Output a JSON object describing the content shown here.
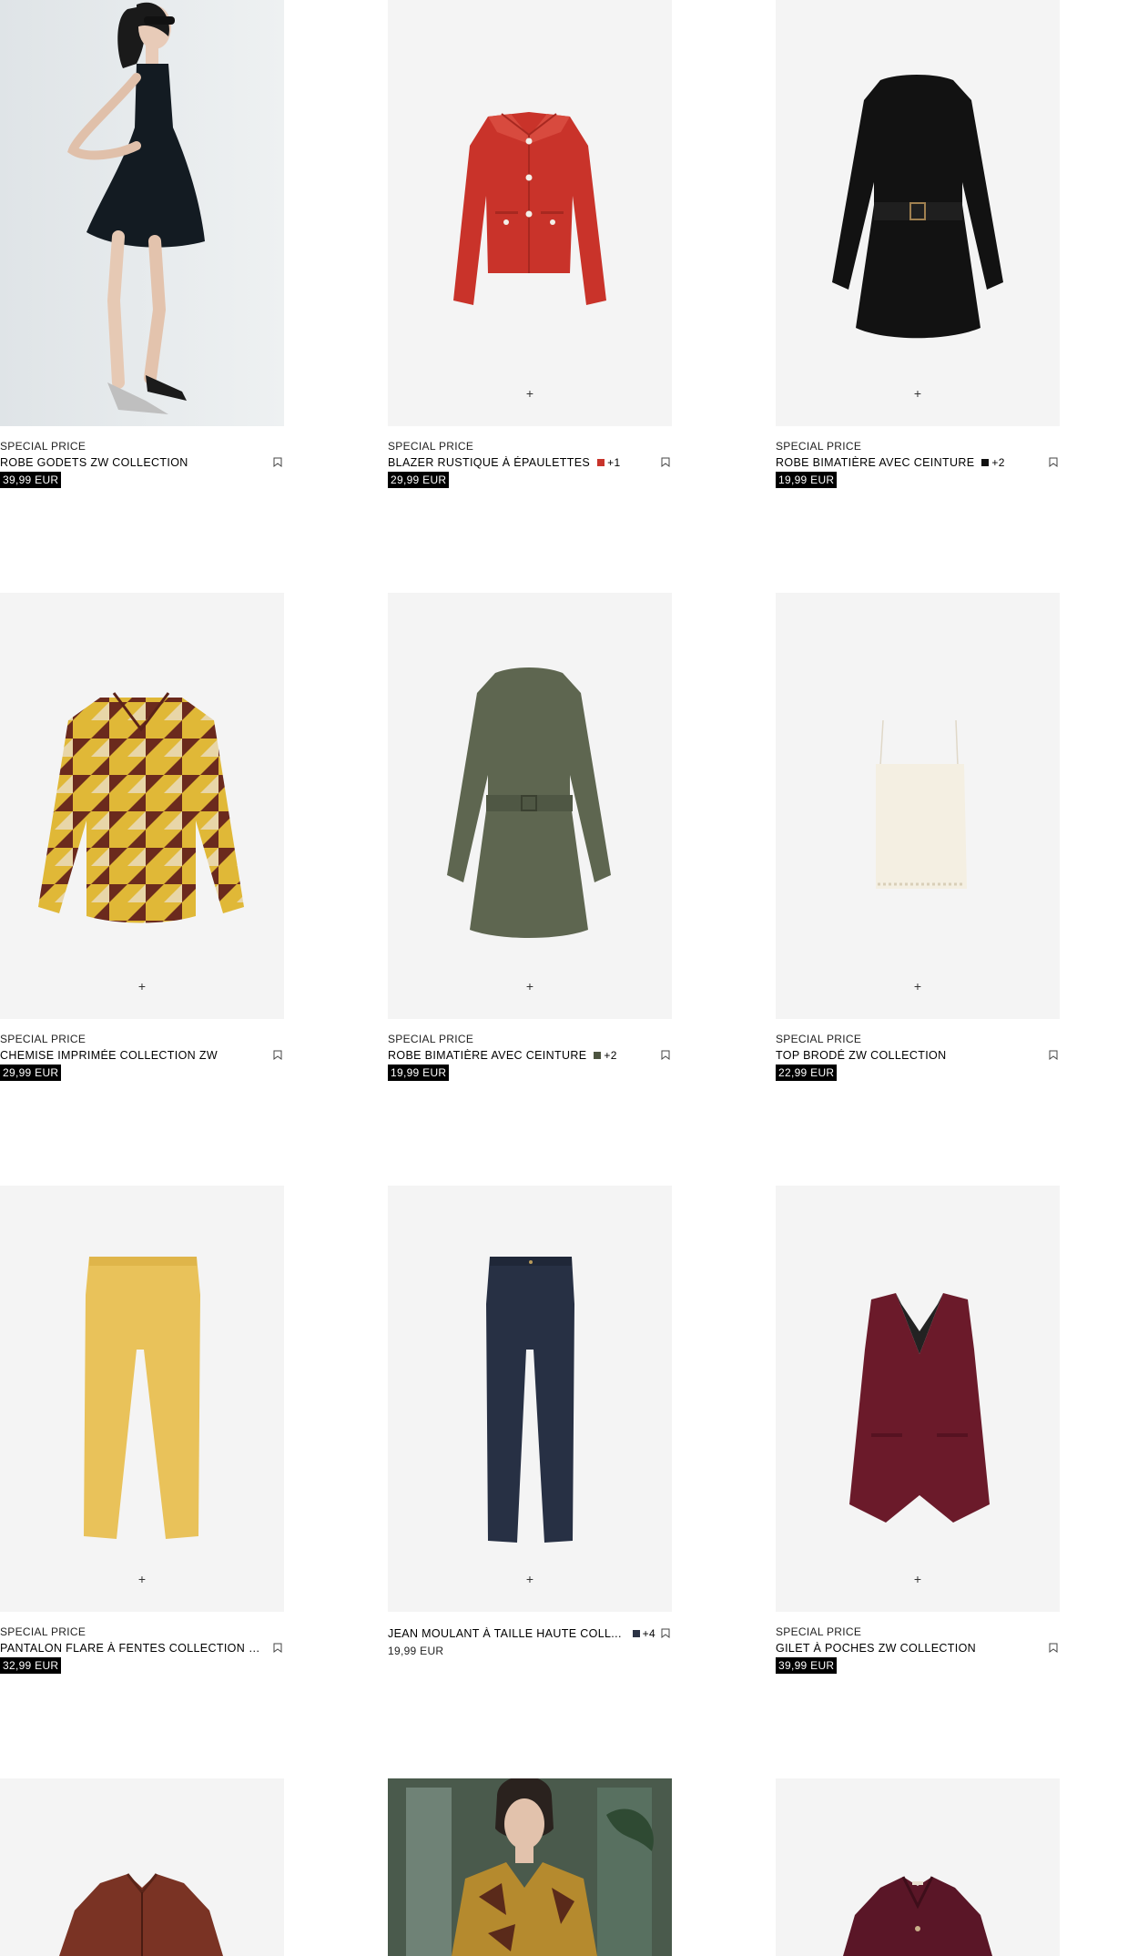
{
  "products": [
    {
      "badge": "SPECIAL PRICE",
      "name": "ROBE GODETS ZW COLLECTION",
      "price": "39,99 EUR",
      "swatch": "",
      "more": "",
      "sale": true,
      "image": "model-dress-photo"
    },
    {
      "badge": "SPECIAL PRICE",
      "name": "BLAZER RUSTIQUE À ÉPAULETTES",
      "price": "29,99 EUR",
      "swatch": "#c8342b",
      "more": "+1",
      "sale": true,
      "image": "red-blazer"
    },
    {
      "badge": "SPECIAL PRICE",
      "name": "ROBE BIMATIÈRE AVEC CEINTURE",
      "price": "19,99 EUR",
      "swatch": "#111111",
      "more": "+2",
      "sale": true,
      "image": "black-belted-dress"
    },
    {
      "badge": "SPECIAL PRICE",
      "name": "CHEMISE IMPRIMÉE COLLECTION ZW",
      "price": "29,99 EUR",
      "swatch": "",
      "more": "",
      "sale": true,
      "image": "printed-shirt"
    },
    {
      "badge": "SPECIAL PRICE",
      "name": "ROBE BIMATIÈRE AVEC CEINTURE",
      "price": "19,99 EUR",
      "swatch": "#4d5440",
      "more": "+2",
      "sale": true,
      "image": "khaki-belted-dress"
    },
    {
      "badge": "SPECIAL PRICE",
      "name": "TOP BRODÉ ZW COLLECTION",
      "price": "22,99 EUR",
      "swatch": "",
      "more": "",
      "sale": true,
      "image": "cream-top"
    },
    {
      "badge": "SPECIAL PRICE",
      "name": "PANTALON FLARE À FENTES COLLECTION ZW",
      "price": "32,99 EUR",
      "swatch": "",
      "more": "",
      "sale": true,
      "image": "yellow-pants"
    },
    {
      "badge": "",
      "name": "JEAN MOULANT À TAILLE HAUTE COLL...",
      "price": "19,99 EUR",
      "swatch": "#2b3345",
      "more": "+4",
      "sale": false,
      "image": "dark-jeans"
    },
    {
      "badge": "SPECIAL PRICE",
      "name": "GILET À POCHES ZW COLLECTION",
      "price": "39,99 EUR",
      "swatch": "",
      "more": "",
      "sale": true,
      "image": "burgundy-vest"
    },
    {
      "badge": "",
      "name": "",
      "price": "",
      "swatch": "",
      "more": "",
      "sale": false,
      "image": "brown-leather-jacket"
    },
    {
      "badge": "",
      "name": "",
      "price": "",
      "swatch": "",
      "more": "",
      "sale": false,
      "image": "model-printed-shirt-photo"
    },
    {
      "badge": "",
      "name": "",
      "price": "",
      "swatch": "",
      "more": "",
      "sale": false,
      "image": "burgundy-cardigan"
    }
  ],
  "ui": {
    "plus_symbol": "+"
  }
}
